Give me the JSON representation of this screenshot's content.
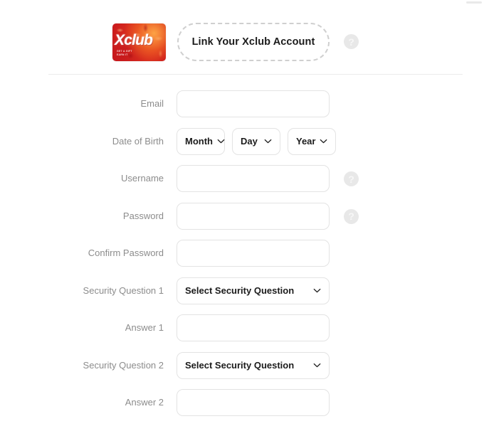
{
  "header": {
    "card": {
      "wordmark": "Xclub",
      "subtext_line1": "GET A GIFT",
      "subtext_line2": "EARN IT",
      "name": "xclub-membership-card"
    },
    "link_button_label": "Link Your Xclub Account",
    "help_icon_glyph": "?"
  },
  "form": {
    "rows": [
      {
        "label": "Email",
        "type": "text",
        "value": "",
        "placeholder": "",
        "help": false,
        "name": "email"
      },
      {
        "label": "Date of Birth",
        "type": "dob",
        "help": false,
        "name": "date-of-birth",
        "month": "Month",
        "day": "Day",
        "year": "Year"
      },
      {
        "label": "Username",
        "type": "text",
        "value": "",
        "placeholder": "",
        "help": true,
        "name": "username"
      },
      {
        "label": "Password",
        "type": "text",
        "value": "",
        "placeholder": "",
        "help": true,
        "name": "password"
      },
      {
        "label": "Confirm Password",
        "type": "text",
        "value": "",
        "placeholder": "",
        "help": false,
        "name": "confirm-password"
      },
      {
        "label": "Security Question 1",
        "type": "select",
        "value": "Select Security Question",
        "help": false,
        "name": "security-question-1"
      },
      {
        "label": "Answer 1",
        "type": "text",
        "value": "",
        "placeholder": "",
        "help": false,
        "name": "answer-1"
      },
      {
        "label": "Security Question 2",
        "type": "select",
        "value": "Select Security Question",
        "help": false,
        "name": "security-question-2"
      },
      {
        "label": "Answer 2",
        "type": "text",
        "value": "",
        "placeholder": "",
        "help": false,
        "name": "answer-2"
      }
    ]
  },
  "colors": {
    "card_red": "#c8161c",
    "card_orange": "#f07a2a",
    "border": "#e3e3e3",
    "label_gray": "#8c8c8c",
    "help_circle": "#e8e8e8",
    "divider": "#ebebeb"
  }
}
